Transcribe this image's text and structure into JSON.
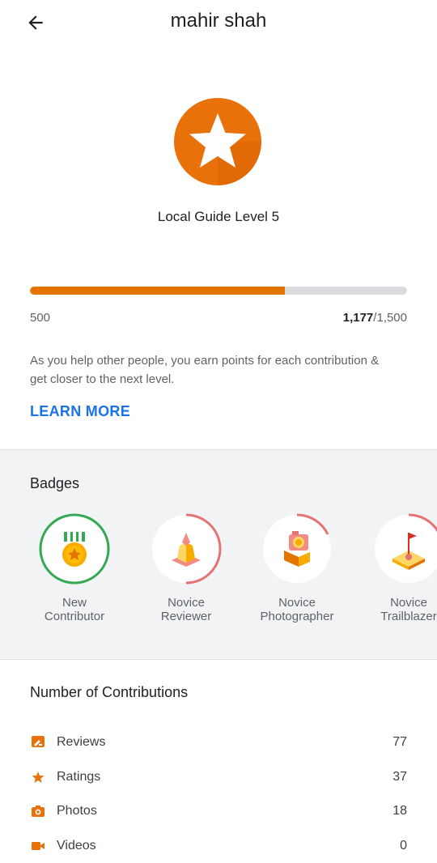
{
  "header": {
    "title": "mahir shah",
    "back_icon": "arrow-back-icon"
  },
  "level": {
    "label": "Local Guide Level 5",
    "icon": "star-icon",
    "color": "#E8710A"
  },
  "progress": {
    "min_label": "500",
    "current_points": "1,177",
    "max_points": "/1,500",
    "fraction": 0.677,
    "fill_color": "#E37400"
  },
  "info": {
    "text": "As you help other people, you earn points for each contribution & get closer to the next level.",
    "learn_more": "LEARN MORE"
  },
  "badges": {
    "title": "Badges",
    "items": [
      {
        "line1": "New",
        "line2": "Contributor",
        "icon": "medal-icon"
      },
      {
        "line1": "Novice",
        "line2": "Reviewer",
        "icon": "reviewer-icon"
      },
      {
        "line1": "Novice",
        "line2": "Photographer",
        "icon": "camera-icon"
      },
      {
        "line1": "Novice",
        "line2": "Trailblazer",
        "icon": "flag-icon"
      }
    ]
  },
  "contributions": {
    "title": "Number of Contributions",
    "items": [
      {
        "label": "Reviews",
        "value": "77",
        "icon": "review-icon"
      },
      {
        "label": "Ratings",
        "value": "37",
        "icon": "star-icon"
      },
      {
        "label": "Photos",
        "value": "18",
        "icon": "camera-icon"
      },
      {
        "label": "Videos",
        "value": "0",
        "icon": "video-icon"
      }
    ]
  },
  "colors": {
    "accent": "#E8710A",
    "link": "#1A73E8",
    "badge_green": "#34A853",
    "badge_ring_red": "#E57373"
  }
}
